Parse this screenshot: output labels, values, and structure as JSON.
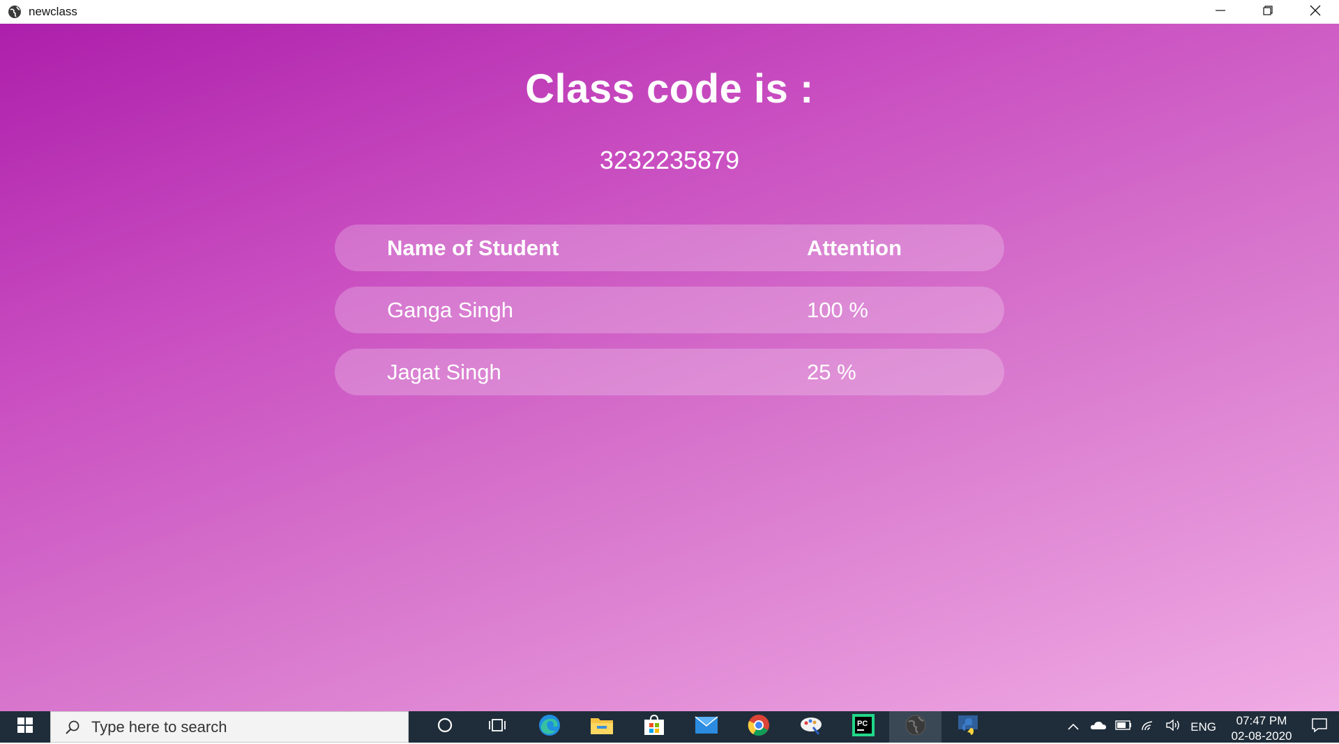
{
  "window": {
    "title": "newclass",
    "app_icon": "globe-icon",
    "controls": [
      "minimize-icon",
      "restore-icon",
      "close-icon"
    ]
  },
  "main": {
    "heading": "Class code is :",
    "class_code": "3232235879"
  },
  "table": {
    "headers": [
      "Name of Student",
      "Attention"
    ],
    "rows": [
      {
        "name": "Ganga Singh",
        "attention": "100 %"
      },
      {
        "name": "Jagat Singh",
        "attention": "25 %"
      }
    ]
  },
  "taskbar": {
    "start_icon": "windows-start-icon",
    "search_placeholder": "Type here to search",
    "search_icon": "search-icon",
    "pinned_icons": [
      "cortana-icon",
      "task-view-icon",
      "edge-icon",
      "file-explorer-icon",
      "store-icon",
      "mail-icon",
      "chrome-icon",
      "paint-icon",
      "pycharm-icon",
      "globe-app-icon",
      "python-icon"
    ],
    "tray": {
      "icons": [
        "chevron-up-icon",
        "onedrive-icon",
        "battery-icon",
        "wifi-icon",
        "volume-icon"
      ],
      "language": "ENG",
      "time": "07:47 PM",
      "date": "02-08-2020",
      "notification_icon": "notification-icon"
    }
  },
  "colors": {
    "gradient_start": "#ad1fab",
    "gradient_end": "#f0abe4",
    "taskbar": "#1f2d3a"
  }
}
